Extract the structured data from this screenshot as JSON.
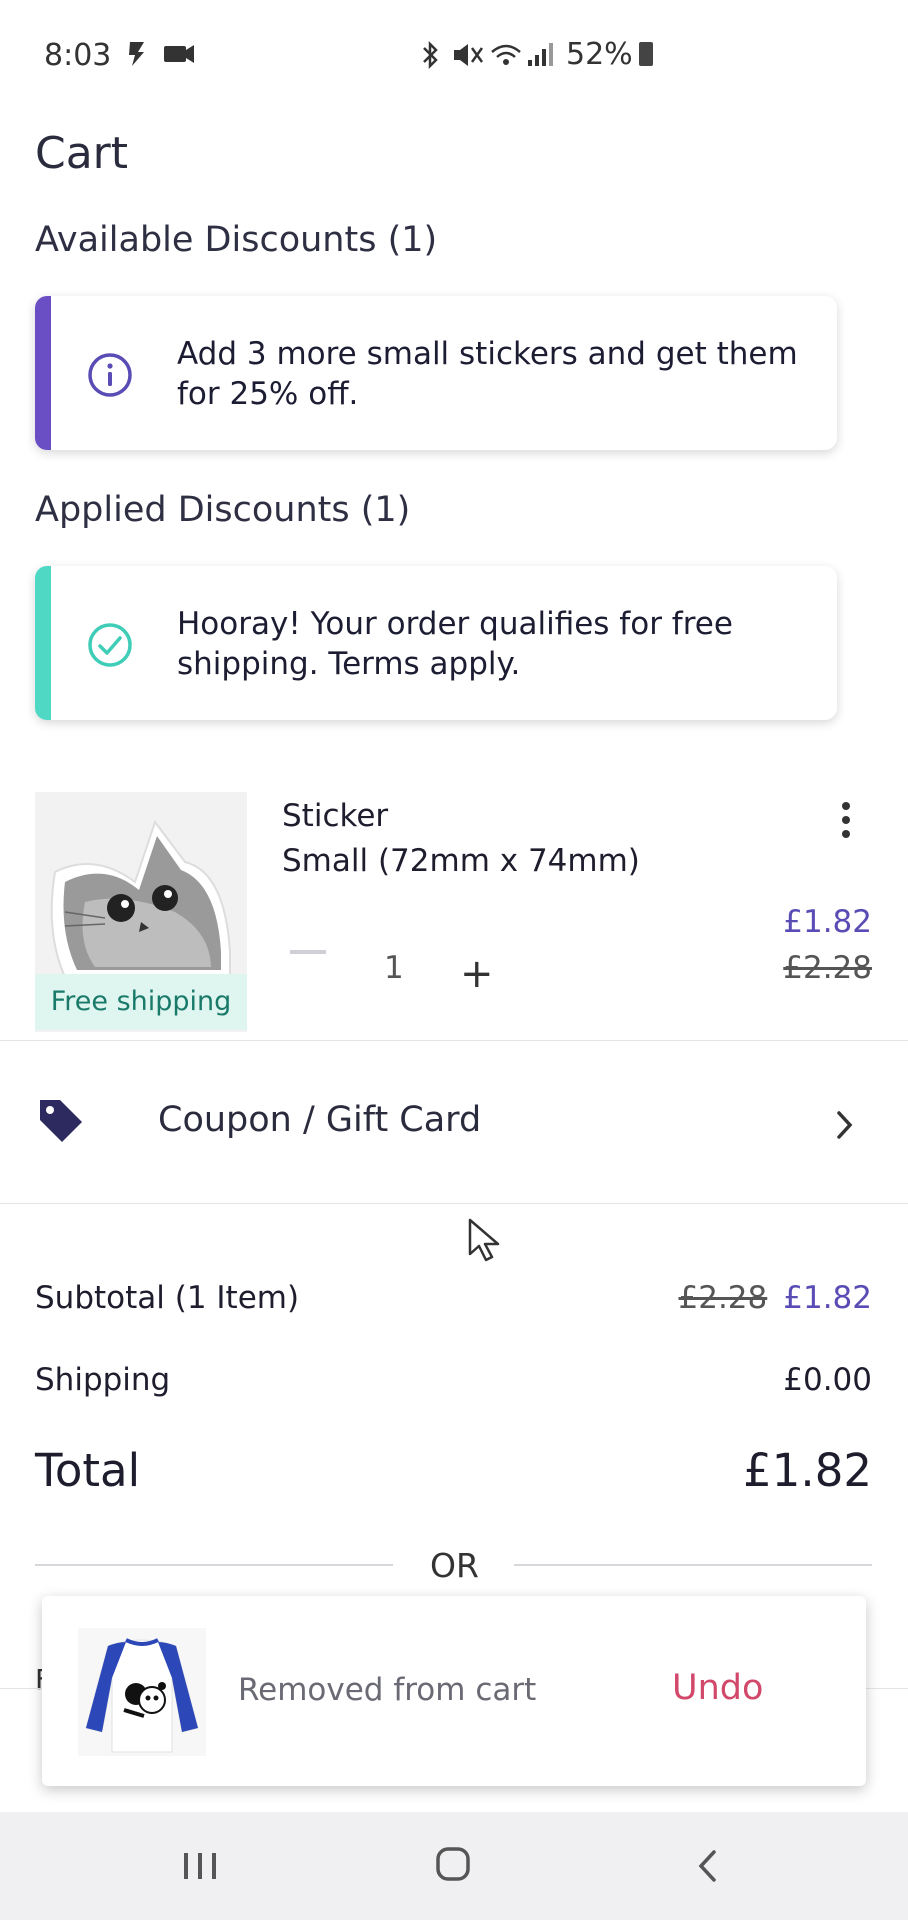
{
  "status_bar": {
    "time": "8:03",
    "battery": "52%"
  },
  "page": {
    "title": "Cart"
  },
  "available_discounts": {
    "heading": "Available Discounts (1)",
    "message": "Add 3 more small stickers and get them for 25% off.",
    "accent_color": "#6a4fc4",
    "icon": "info-icon"
  },
  "applied_discounts": {
    "heading": "Applied Discounts (1)",
    "message": "Hooray! Your order qualifies for free shipping. Terms apply.",
    "accent_color": "#4fd8c4",
    "icon": "check-circle-icon"
  },
  "cart_item": {
    "name": "Sticker",
    "size": "Small (72mm x 74mm)",
    "badge": "Free shipping",
    "quantity": "1",
    "price_new": "£1.82",
    "price_old": "£2.28"
  },
  "coupon": {
    "label": "Coupon / Gift Card",
    "icon": "tag-icon"
  },
  "summary": {
    "subtotal_label": "Subtotal (1 Item)",
    "subtotal_old": "£2.28",
    "subtotal_new": "£1.82",
    "shipping_label": "Shipping",
    "shipping_value": "£0.00",
    "total_label": "Total",
    "total_value": "£1.82"
  },
  "or_text": "OR",
  "toast": {
    "message": "Removed from cart",
    "action": "Undo"
  },
  "behind_toast_text": "F"
}
